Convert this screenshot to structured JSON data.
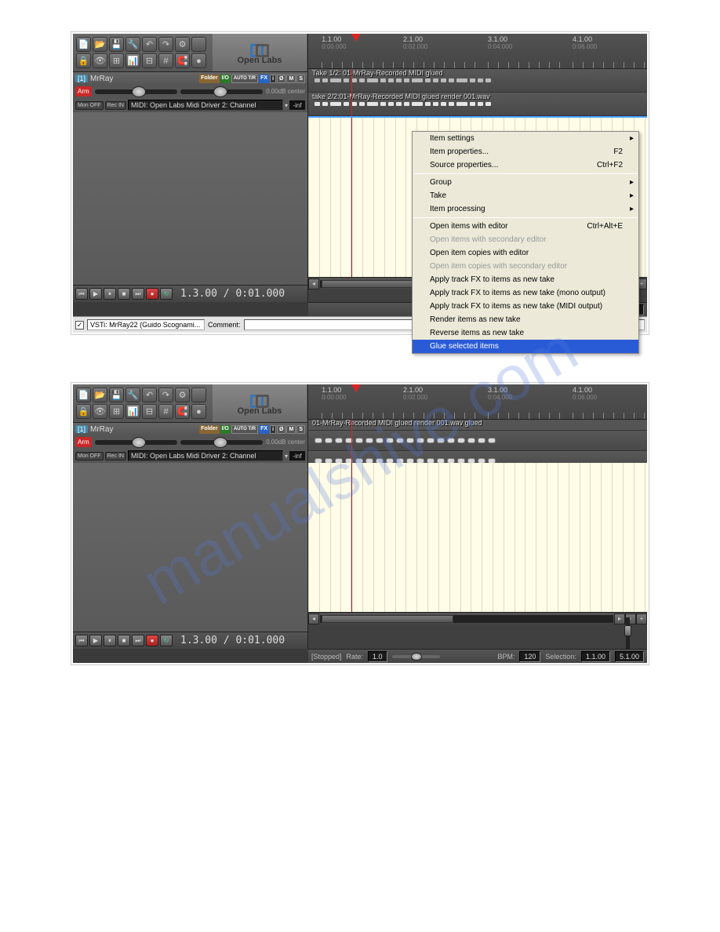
{
  "logo": "Open Labs",
  "track": {
    "num": "[1]",
    "name": "MrRay",
    "badges": {
      "folder": "Folder",
      "io": "I/O",
      "auto": "AUTO\nT/R",
      "fx": "FX",
      "inv": "i",
      "phi": "Ø",
      "m": "M",
      "s": "S"
    },
    "arm": "Arm",
    "vol1": "0.00dB center",
    "vol2": "0.00dB center",
    "mon": "Mon\nOFF",
    "rec": "Rec\nIN",
    "input": "MIDI: Open Labs Midi Driver 2: Channel",
    "meter": "-inf"
  },
  "transport": {
    "time": "1.3.00 / 0:01.000"
  },
  "ruler": [
    {
      "pos": 4,
      "t": "1.1.00",
      "s": "0:00.000"
    },
    {
      "pos": 28,
      "t": "2.1.00",
      "s": "0:02.000"
    },
    {
      "pos": 53,
      "t": "3.1.00",
      "s": "0:04.000"
    },
    {
      "pos": 78,
      "t": "4.1.00",
      "s": "0:06.000"
    }
  ],
  "lane1a": "Take 1/2: 01-MrRay-Recorded MIDI glued",
  "lane1b": "take 2/2:01-MrRay-Recorded MIDI glued render 001.wav",
  "lane2": "01-MrRay-Recorded MIDI glued render 001.wav glued",
  "status": {
    "state": "[Stopped]",
    "rate_l": "Rate:",
    "rate": "1.0",
    "bpm_l": "BPM:",
    "bpm": "120",
    "sel_l": "Selection:",
    "sel_a": "1.1.00",
    "sel_b": "5.1.00"
  },
  "bottom": {
    "check": "✓",
    "fx": "VSTi: MrRay22 (Guido Scognami...",
    "comm": "Comment:"
  },
  "menu": [
    {
      "t": "Item settings",
      "sub": true
    },
    {
      "t": "Item properties...",
      "k": "F2"
    },
    {
      "t": "Source properties...",
      "k": "Ctrl+F2"
    },
    {
      "sep": true
    },
    {
      "t": "Group",
      "sub": true
    },
    {
      "t": "Take",
      "sub": true
    },
    {
      "t": "Item processing",
      "sub": true
    },
    {
      "sep": true
    },
    {
      "t": "Open items with editor",
      "k": "Ctrl+Alt+E"
    },
    {
      "t": "Open items with secondary editor",
      "dis": true
    },
    {
      "t": "Open item copies with editor"
    },
    {
      "t": "Open item copies with secondary editor",
      "dis": true
    },
    {
      "t": "Apply track FX to items as new take"
    },
    {
      "t": "Apply track FX to items as new take (mono output)"
    },
    {
      "t": "Apply track FX to items as new take (MIDI output)"
    },
    {
      "t": "Render items as new take"
    },
    {
      "t": "Reverse items as new take"
    },
    {
      "t": "Glue selected items",
      "hl": true
    }
  ],
  "toolbar_icons": [
    "📄",
    "📂",
    "💾",
    "🔧",
    "↶",
    "↷",
    "⚙",
    "",
    "🔒",
    "👁",
    "⊞",
    "📊",
    "⊟",
    "#",
    "🧲",
    "●"
  ]
}
